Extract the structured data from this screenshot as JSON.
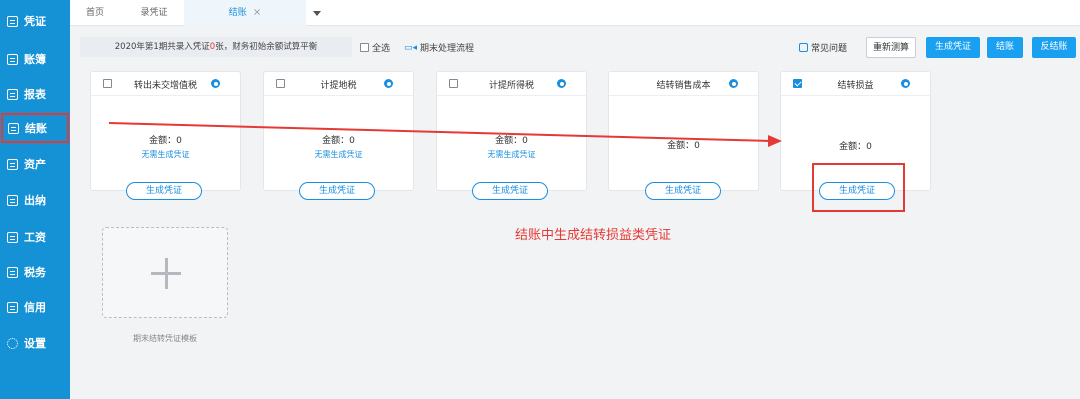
{
  "sidebar": {
    "items": [
      {
        "label": "凭证"
      },
      {
        "label": "账簿"
      },
      {
        "label": "报表"
      },
      {
        "label": "结账"
      },
      {
        "label": "资产"
      },
      {
        "label": "出纳"
      },
      {
        "label": "工资"
      },
      {
        "label": "税务"
      },
      {
        "label": "信用"
      },
      {
        "label": "设置"
      }
    ],
    "active": "结账"
  },
  "tabs": [
    {
      "label": "首页"
    },
    {
      "label": "录凭证"
    },
    {
      "label": "结账",
      "close": "×"
    }
  ],
  "toolbar": {
    "info_prefix": "2020年第1期共录入凭证",
    "info_count": "0",
    "info_suffix": "张，财务初始余额试算平衡",
    "select_all": "全选",
    "period_flow": "期末处理流程",
    "faq": "常见问题",
    "recalc": "重新测算",
    "generate": "生成凭证",
    "close_account": "结账",
    "reverse_close": "反结账"
  },
  "cards": [
    {
      "title": "转出未交增值税",
      "amount": "金额：0",
      "note": "无需生成凭证",
      "button": "生成凭证"
    },
    {
      "title": "计提地税",
      "amount": "金额：0",
      "note": "无需生成凭证",
      "button": "生成凭证"
    },
    {
      "title": "计提所得税",
      "amount": "金额：0",
      "note": "无需生成凭证",
      "button": "生成凭证"
    },
    {
      "title": "结转销售成本",
      "amount": "金额：0",
      "button": "生成凭证"
    },
    {
      "title": "结转损益",
      "amount": "金额：0",
      "button": "生成凭证",
      "checked": true
    }
  ],
  "template": {
    "label": "期末结转凭证模板"
  },
  "annotation": "结账中生成结转损益类凭证",
  "colors": {
    "sidebar": "#1591d6",
    "accent": "#1a8fe0",
    "annotation_red": "#e53935"
  }
}
